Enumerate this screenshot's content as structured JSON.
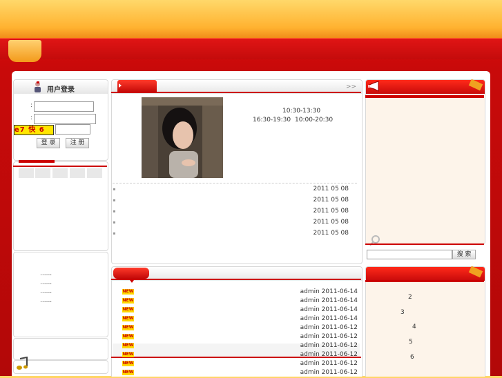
{
  "login": {
    "title": "用户登录",
    "captcha": "e7 快 6",
    "login_button": "登 录",
    "register_button": "注 册"
  },
  "left_list": {
    "items": [
      "......",
      "......",
      "......",
      "......"
    ]
  },
  "feature": {
    "more": ">>",
    "hours_line1": "10:30-13:30",
    "hours_line2_a": "16:30-19:30",
    "hours_line2_b": "10:00-20:30"
  },
  "news": [
    {
      "date": "2011 05 08"
    },
    {
      "date": "2011 05 08"
    },
    {
      "date": "2011 05 08"
    },
    {
      "date": "2011 05 08"
    },
    {
      "date": "2011 05 08"
    }
  ],
  "latest": [
    {
      "meta": "admin 2011-06-14"
    },
    {
      "meta": "admin 2011-06-14"
    },
    {
      "meta": "admin 2011-06-14"
    },
    {
      "meta": "admin 2011-06-14"
    },
    {
      "meta": "admin 2011-06-12"
    },
    {
      "meta": "admin 2011-06-12"
    },
    {
      "meta": "admin 2011-06-12"
    },
    {
      "meta": "admin 2011-06-12"
    },
    {
      "meta": "admin 2011-06-12"
    },
    {
      "meta": "admin 2011-06-12"
    }
  ],
  "new_badge": "NEW",
  "search": {
    "button": "搜 索",
    "value": ""
  },
  "ranking": [
    "2",
    "3",
    "4",
    "5",
    "6"
  ],
  "colors": {
    "brand_red": "#c80a0a",
    "brand_orange": "#f39a1a"
  }
}
